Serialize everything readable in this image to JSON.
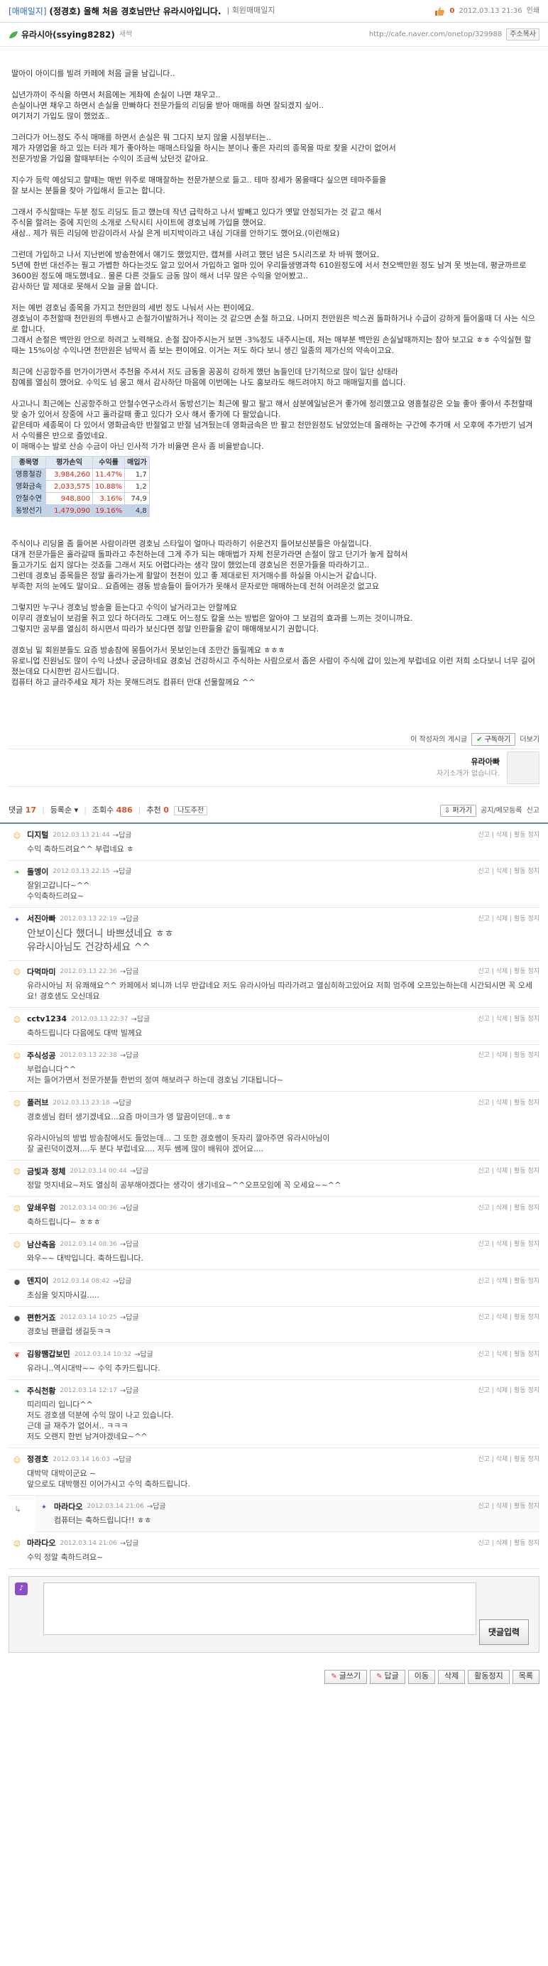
{
  "header": {
    "category": "[매매일지]",
    "title": "(정경호) 올해 처음 경호님만난 유라시아입니다.",
    "board": "| 회원매매일지",
    "like_count": "0",
    "date": "2012.03.13 21:36",
    "print_label": "인쇄"
  },
  "author": {
    "name": "유라시아(ssying8282)",
    "grade": "새싹",
    "url": "http://cafe.naver.com/onetop/329988",
    "addr_copy": "주소복사"
  },
  "article": {
    "paragraphs": [
      "딸아이 아이디를 빌려 카페에 처음 글을 남깁니다..",
      "",
      "십년가까이 주식을 하면서 처음에는 게좌에 손실이 나면 채우고..",
      "손실이나면 채우고 하면서 손실을 만빠하다 전문가들의 리딩을 받아 매매를 하면 잘되겠지 싶어..",
      "여기저기 가입도 많이 했었죠..",
      "",
      "그러다가 어느정도 주식 매매를 하면서 손실은 뭐 그다지 보지 않을 시점부터는..",
      "제가 자영업을 하고 있는 터라 제가 좋아하는 매매스타일을 하시는 분이나 좋은 자리의 종목을 따로 찾을 시간이 없어서",
      "전문가방을 가입을 할때부터는 수익이 조금씩 났던것 같아요.",
      "",
      "지수가 등락 예상되고 할때는 매번 위주로 매매잘하는 전문가분으로 들고.. 테마 장세가 몽을때다 싶으면 테마주들을",
      "잘 보시는 분들을 찾아 가입해서 듣고는 합니다.",
      "",
      "그래서 주식할때는 두분 정도 리딩도 듣고 했는데 작년 급락하고 나서 발빼고 있다가 옛말 안정되가는 것 같고 해서",
      "주식을 할려는 중에 지인의 소개로 스탁시티 사이트에 경호님께 가입을 했어요.",
      "새삼.. 제가 뭐든 리딩에 반감이라서 사실 은게 비지박이라고 내심 기대를 안하기도 했어요.(이런해요)",
      "",
      "그런데 가입하고 나서 지난번에 방송한에서 얘기도 했었지만, 캡쳐를 사려고 했던 넘은 5시리즈로 차 바꿔 했어요.",
      "5년에 한번 대선주는 필고 가볍한 하다는것도 알고 있어서 가입하고 얼마 있어 우리들생명과학 610원정도에 서서 천오백만원 정도 남겨 못 벗는데, 평균까르로 3600원 정도에 매도했네요.. 물론 다른 것들도 금동 많이 해서 너무 많은 수익을 얻어봤고..",
      "감사하단 말 제대로 못해서 오늘 글을 씁니다.",
      "",
      "저는 예번 경호님 종목을 가지고 천만원의 세번 정도 나눠서 사는 편이에요.",
      "경호님이 추천할때 천만원의 투밴사고 손절가이발하거나 적이는 것 같으면 손절 하고요. 나머지 천만원은 박스권 돌파하거나 수급이 강하게 들어올때 더 사는 식으로 합니다.",
      "그래서 손절은 백만원 안으로 하려고 노력해요. 손절 잡아주시는거 보면 -3%정도 내주시는데, 저는 매부분 백만원 손실날때까지는 참아 보고요 ㅎㅎ 수익실현 할때는 15%이상 수익나면 천만원은 넘딱서 좀 보는 편이에요. 이거는 저도 하다 보니 생긴 일종의 제가신의 약속이고요.",
      "",
      "최근에 신공항주를 먼가이가면서 추천을 주셔서 저도 금동을 꽁꽁히 강하게 했던 놈들인데 단기적으로 많이 일단 상태라",
      "참예를 열심히 했어요. 수익도 넘 몽고 해서 감사하단 마음에 이번에는 나도 홍보라도 해드려야지 하고 매매일지를 씁니다.",
      "",
      "사고나니 최근에는 신공항주하고 안철수연구소라서 동방선기는 최근에 팔고 팔고 해서 삼분에일남은거 좋가에 정리했고요 영흥철강은 오늘 좋아 좋아서 추천할때 맞 숭가 있어서 장중에 사고 홀라갈때 좋고 있다가 오사 해서 좋가에 다 팔았습니다.",
      "같은테마 세종목이 다 있어서 영화금속만 반절얼고 반절 넘겨뒀는데 영화금속은 반 팔고 천만원정도 남았었는데 올래하는 구간에 추가매 서 오후에 추가반기 넘겨서 수익률은 반으로 즐었네요.",
      "이 매매수는 발로 산승 수금이 아닌 인사적 가가 비율면 은사 좀 비율받습니다."
    ],
    "table_headers": [
      "종목명",
      "평가손익",
      "수익률",
      "매입가"
    ],
    "table_rows": [
      {
        "name": "영흥철강",
        "pnl": "3,984,260",
        "rate": "11.47%",
        "buy": "1,7"
      },
      {
        "name": "영화금속",
        "pnl": "2,033,575",
        "rate": "10.88%",
        "buy": "1,2"
      },
      {
        "name": "안철수연",
        "pnl": "948,800",
        "rate": "3.16%",
        "buy": "74,9"
      },
      {
        "name": "동방선기",
        "pnl": "1,479,090",
        "rate": "19.16%",
        "buy": "4,8"
      }
    ],
    "paragraphs2": [
      "주식이나 리딩을 좀 들어본 사람이라면 경호님 스타일이 얼마나 따라하기 쉬운건지 들어보신분들은 아실껍니다.",
      "대개 전문가들은 홀라갈때 돌파라고 추천하는데 그게 주가 되는 매매법가 자체 전문가라면 손절이 많고 단기가 놓게 잡혀서",
      "돌고가기도 쉽지 않다는 것죠들 그래서 저도 어렵다라는 생각 많이 했었는데 경호님은 전문가들을 따라하기고..",
      "그런데 경호님 종목들은 정말 홀라가는게 활말이 천천이 있고 좋 제대로된 저거매수를 하실을 아시는거 같습니다.",
      "부족한 저의 눈에도 말이요.. 요즘에는 경동 방송들이 들어가가 못해서 문자로만 매매하는데 전혀 어려운것 없고요",
      "",
      "그렇지만 누구나 경호님 방송을 듣는다고 수익이 날거라고는 안할께요",
      "이무리 경호님이 보검을 쥐고 있다 하더라도 그래도 어느정도 칼을 쓰는 방법은 알아야 그 보검의 효과를 느끼는 것이니까요.",
      "그렇지만 공부를 열심히 하시면서 따라가 보신다면 정말 인판들을 같이 매매해보시기 권합니다.",
      "",
      "경호님 밑 회원분들도 요즘 방송참에 몽틀어가서 못보인는데 조만간 돌릴께요 ㅎㅎㅎ",
      "유로니업 진원님도 많이 수익 나셨나 궁금하네요 경호님 건강하시고 주식하는 사람으로서 좀은 사람이 주식에 갑이 있는게 부럽네요 이런 저희 소다보니 너무 길어졌는데요 다시한번 감사드립니다.",
      "컴퓨터 하고 글라주세요 제가 차는 못해드려도 컴퓨터 만대 선물할께요 ^^"
    ]
  },
  "post_tools": {
    "board_view": "이 작성자의 게시글",
    "subscribe": "구독하기",
    "more": "더보기"
  },
  "writer": {
    "nick": "유라아빠",
    "sub": "자기소개가 없습니다."
  },
  "comment_bar": {
    "count_label": "댓글",
    "count": "17",
    "order": "등록순",
    "views_label": "조회수",
    "views": "486",
    "recommend_label": "추천",
    "recommend": "0",
    "recommend_btn": "나도추천",
    "share": "퍼가기",
    "public": "공지/메모등록",
    "report": "신고"
  },
  "comments": [
    {
      "name": "디지털",
      "date": "2012.03.13 21:44",
      "reply": "답글",
      "text": "수익 축하드려요^^ 부럽네요 ㅎ",
      "color": "#f0a020",
      "icon": "☺",
      "big": false,
      "reply_to": false
    },
    {
      "name": "돌멩이",
      "date": "2012.03.13 22:15",
      "reply": "답글",
      "text": "잘읽고갑니다~^^\n수익축하드려요~",
      "color": "#4caf50",
      "icon": "❧",
      "big": false,
      "reply_to": false
    },
    {
      "name": "서진아빠",
      "date": "2012.03.13 22:19",
      "reply": "답글",
      "text": "안보이신다 했더니 바쁘셨네요 ㅎㅎ\n유라시아님도 건강하세요 ^^",
      "color": "#7b3fb5",
      "icon": "✦",
      "big": true,
      "reply_to": false
    },
    {
      "name": "다먹마미",
      "date": "2012.03.13 22:36",
      "reply": "답글",
      "text": "유라시아님 저 유쾌해요^^ 카페에서 뵈니까 너무 반갑네요 저도 유라시아님 따라가려고 열심히하고있어요 저희 엄주에 오프있는하는데 시간되시면 꼭 오세요! 경호샘도 오신데요",
      "color": "#f0a020",
      "icon": "☺",
      "big": false,
      "reply_to": false
    },
    {
      "name": "cctv1234",
      "date": "2012.03.13 22:37",
      "reply": "답글",
      "text": "축하드립니다 다음에도 대박 빌께요",
      "color": "#f0a020",
      "icon": "☺",
      "big": false,
      "reply_to": false
    },
    {
      "name": "주식성공",
      "date": "2012.03.13 22:38",
      "reply": "답글",
      "text": "부럽습니다^^\n저는 들어가면서 전문가분들 한번의 정여 해보려구 하는데 경호님 기대됩니다~",
      "color": "#f0a020",
      "icon": "☺",
      "big": false,
      "reply_to": false
    },
    {
      "name": "폴러브",
      "date": "2012.03.13 23:18",
      "reply": "답글",
      "text": "경호샘님 컴터 생기겠네요...요즘 마이크가 영 말끔이던데..ㅎㅎ\n\n유라시아님의 방법 방송참에서도 들었는데... 그 또한 경호쌤이 돗자리 깔아주면 유라시아님이\n잘 굴린덕이겠져....두 분다 부럽네요.... 저두 쌤께 많이 배워야 겠어요....",
      "color": "#f0a020",
      "icon": "☺",
      "big": false,
      "reply_to": false
    },
    {
      "name": "금빛과 정체",
      "date": "2012.03.14 00:44",
      "reply": "답글",
      "text": "정말 멋지네요~저도 열심히 공부해야겠다는 생각이 생기네요~^^오프모임에 꼭 오세요~~^^",
      "color": "#f0a020",
      "icon": "☺",
      "big": false,
      "reply_to": false
    },
    {
      "name": "앞쇄우럼",
      "date": "2012.03.14 00:36",
      "reply": "답글",
      "text": "축하드립니다~ ㅎㅎㅎ",
      "color": "#f0a020",
      "icon": "☺",
      "big": false,
      "reply_to": false
    },
    {
      "name": "남산측음",
      "date": "2012.03.14 08:36",
      "reply": "답글",
      "text": "와우~~ 대박입니다. 축하드립니다.",
      "color": "#f0a020",
      "icon": "☺",
      "big": false,
      "reply_to": false
    },
    {
      "name": "덴지이",
      "date": "2012.03.14 08:42",
      "reply": "답글",
      "text": "초심을 잊지마시길.....",
      "color": "#555",
      "icon": "●",
      "big": false,
      "reply_to": false
    },
    {
      "name": "편한거죠",
      "date": "2012.03.14 10:25",
      "reply": "답글",
      "text": "경호님 팬클럽 생길듯ㅋㅋ",
      "color": "#555",
      "icon": "●",
      "big": false,
      "reply_to": false
    },
    {
      "name": "김왕쨈갑보민",
      "date": "2012.03.14 10:32",
      "reply": "답글",
      "text": "유라니..역시대박~~ 수익 추카드립니다.",
      "color": "#d33",
      "icon": "❦",
      "big": false,
      "reply_to": false
    },
    {
      "name": "주식천황",
      "date": "2012.03.14 12:17",
      "reply": "답글",
      "text": "띠리띠리 입니다^^\n저도 경호샘 덕분에 수익 많이 나고 있습니다.\n근데 글 재주가 없어서.. ㅋㅋㅋ\n저도 오랜지 한번 남겨야겠네요~^^",
      "color": "#4caf50",
      "icon": "❧",
      "big": false,
      "reply_to": false
    },
    {
      "name": "정경호",
      "date": "2012.03.14 16:03",
      "reply": "답글",
      "text": "대박막 대박이군요 ~\n앞으로도 대박행진 이어가시고 수익 축하드립니다.",
      "color": "#f0a020",
      "icon": "☺",
      "big": false,
      "reply_to": false
    },
    {
      "name": "마라다오",
      "date": "2012.03.14 21:06",
      "reply": "답글",
      "text": "컴퓨터는 축하드립니다!! ㅎㅎ",
      "color": "#7b3fb5",
      "icon": "✦",
      "big": false,
      "reply_to": true
    },
    {
      "name": "마라다오",
      "date": "2012.03.14 21:06",
      "reply": "답글",
      "text": "수익 정말 축하드려요~",
      "color": "#f0a020",
      "icon": "☺",
      "big": false,
      "reply_to": false
    }
  ],
  "comment_actions": "신고 | 삭제 | 활동 정지",
  "write": {
    "sub": "",
    "submit": "댓글입력"
  },
  "bottom": {
    "write": "글쓰기",
    "reply": "답글",
    "move": "이동",
    "delete": "삭제",
    "stop": "활동정지",
    "list": "목록"
  }
}
